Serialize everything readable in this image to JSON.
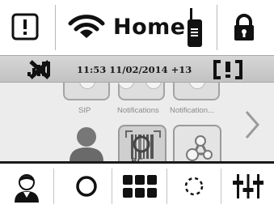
{
  "topbar": {
    "title": "Home",
    "icons": [
      "alert-icon",
      "wifi-icon",
      "radio-icon",
      "lock-icon"
    ]
  },
  "status": {
    "datetime": "11:53 11/02/2014 +13",
    "icons": [
      "no-signal-icon",
      "warning-bracket-icon"
    ]
  },
  "tiles_top_row": [
    {
      "label": "SIP"
    },
    {
      "label": "Notifications"
    },
    {
      "label": "Notification..."
    }
  ],
  "tiles_bottom_row": [
    {
      "icon": "user-icon"
    },
    {
      "icon": "barcode-scanner-icon"
    },
    {
      "icon": "network-icon"
    }
  ],
  "bottombar": {
    "buttons": [
      "user-icon",
      "circle-icon",
      "grid-icon",
      "loading-icon",
      "settings-sliders-icon"
    ]
  },
  "colors": {
    "bar_text": "#111111",
    "status_bg": "#c8c8c8",
    "content_bg": "#ececec",
    "tile_border": "#a4a4a4",
    "label_gray": "#8a8a8a"
  }
}
